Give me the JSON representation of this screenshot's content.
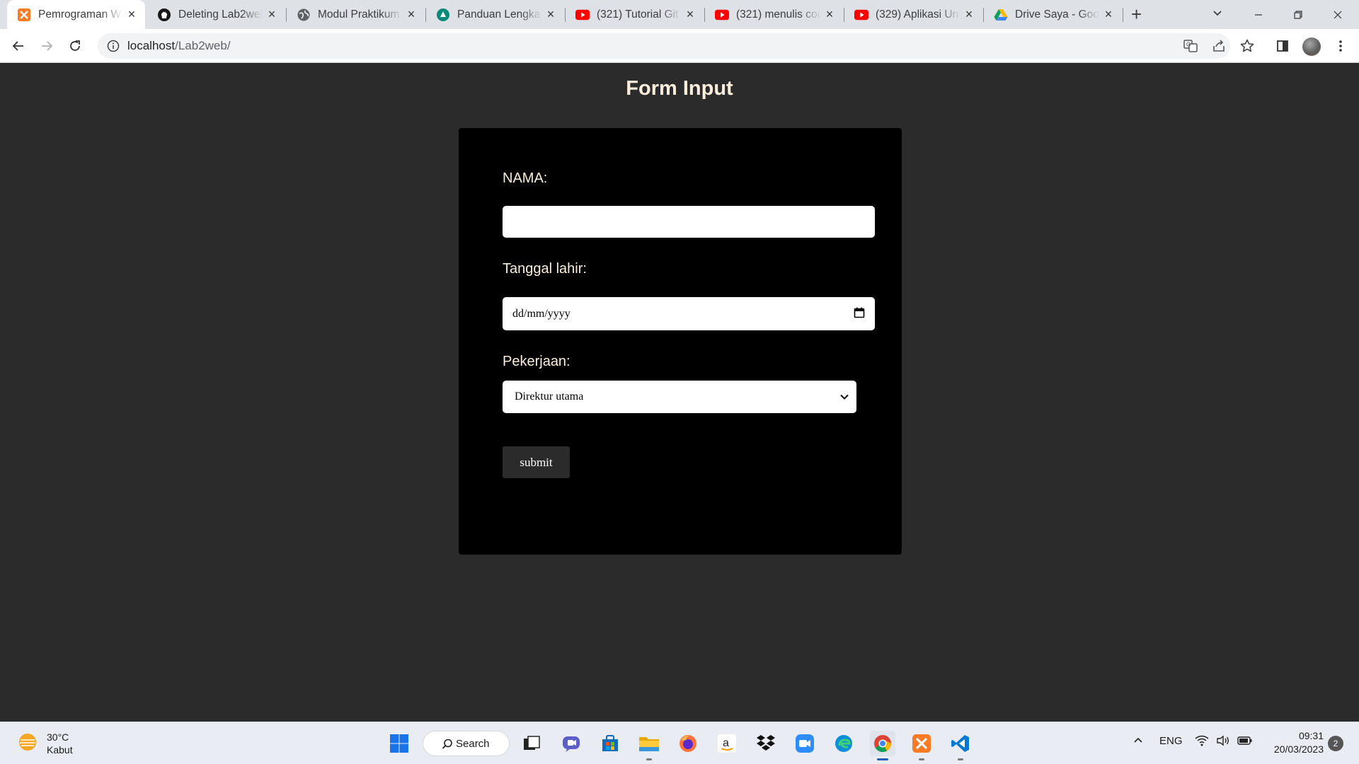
{
  "browser": {
    "tabs": [
      {
        "title": "Pemrograman Web",
        "icon": "xampp-icon",
        "active": true
      },
      {
        "title": "Deleting Lab2web",
        "icon": "github-icon"
      },
      {
        "title": "Modul Praktikum",
        "icon": "globe-icon"
      },
      {
        "title": "Panduan Lengkap",
        "icon": "site-icon"
      },
      {
        "title": "(321) Tutorial Git",
        "icon": "youtube-icon"
      },
      {
        "title": "(321) menulis cod",
        "icon": "youtube-icon"
      },
      {
        "title": "(329) Aplikasi Unt",
        "icon": "youtube-icon"
      },
      {
        "title": "Drive Saya - Goog",
        "icon": "google-drive-icon"
      }
    ],
    "url_host": "localhost",
    "url_path": "/Lab2web/"
  },
  "page": {
    "title": "Form Input",
    "form": {
      "nama_label": "NAMA:",
      "nama_value": "",
      "tanggal_label": "Tanggal lahir:",
      "tanggal_placeholder": "dd/mm/yyyy",
      "pekerjaan_label": "Pekerjaan:",
      "pekerjaan_selected": "Direktur utama",
      "submit_label": "submit"
    }
  },
  "colors": {
    "page_bg": "#2b2b2b",
    "card_bg": "#000000",
    "label_text": "#fbeedc"
  },
  "taskbar": {
    "weather_temp": "30°C",
    "weather_desc": "Kabut",
    "search_label": "Search",
    "language": "ENG",
    "time": "09:31",
    "date": "20/03/2023",
    "notification_count": "2"
  }
}
